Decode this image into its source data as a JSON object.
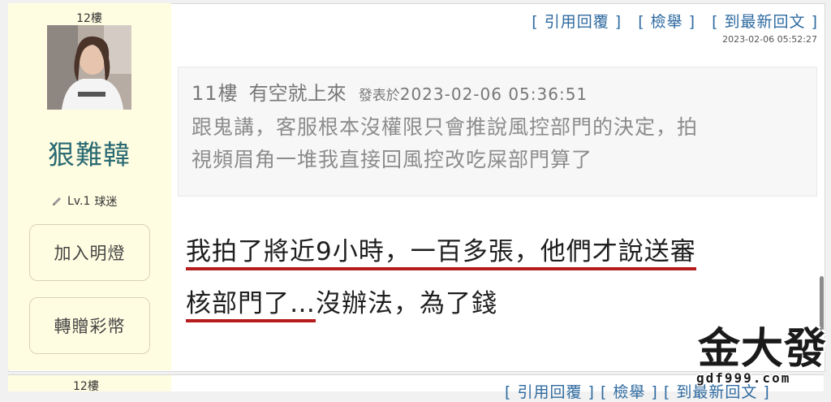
{
  "post": {
    "floor": "12樓",
    "author": {
      "name": "狠難韓",
      "level": "Lv.1",
      "rank": "球迷",
      "avatar_icon": "user-avatar-photo"
    },
    "sidebar_buttons": {
      "light": "加入明燈",
      "gift": "轉贈彩幣"
    },
    "actions": {
      "quote_reply": "[ 引用回覆 ]",
      "report": "[ 檢舉 ]",
      "latest": "[ 到最新回文 ]"
    },
    "timestamp": "2023-02-06 05:52:27",
    "quote": {
      "floor": "11樓",
      "user": "有空就上來",
      "prefix": "發表於",
      "time": "2023-02-06 05:36:51",
      "line1": "跟鬼講，客服根本沒權限只會推說風控部門的決定，拍",
      "line2": "視頻眉角一堆我直接回風控改吃屎部門算了"
    },
    "reply": {
      "line1": "我拍了將近9小時，一百多張，他們才說送審",
      "line2_highlighted": "核部門了…",
      "line2_rest": "沒辦法，為了錢"
    }
  },
  "next_post": {
    "floor": "12樓",
    "actions": "[ 引用回覆 ]   [ 檢舉 ]   [ 到最新回文 ]"
  },
  "watermark": {
    "title": "金大發",
    "url": "gdf999.com"
  },
  "colors": {
    "sidebar_bg": "#fffde1",
    "action_link": "#2e6aa0",
    "username": "#2a6a73",
    "highlight_underline": "#b71c1c"
  }
}
